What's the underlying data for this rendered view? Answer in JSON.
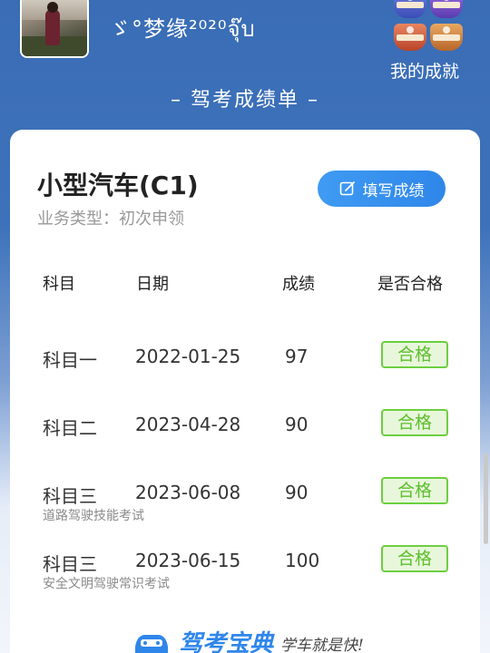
{
  "header": {
    "nickname": "ゞ°梦缘²⁰²⁰จุ๊บ",
    "my_scores_label": "我的成就",
    "page_heading": "– 驾考成绩单 –"
  },
  "card": {
    "vehicle_title": "小型汽车(C1)",
    "business_type": "业务类型：初次申领",
    "fill_button_label": "填写成绩",
    "columns": [
      "科目",
      "日期",
      "成绩",
      "是否合格"
    ],
    "rows": [
      {
        "subject": "科目一",
        "date": "2022-01-25",
        "score": "97",
        "result": "合格",
        "note": ""
      },
      {
        "subject": "科目二",
        "date": "2023-04-28",
        "score": "90",
        "result": "合格",
        "note": ""
      },
      {
        "subject": "科目三",
        "date": "2023-06-08",
        "score": "90",
        "result": "合格",
        "note": "道路驾驶技能考试"
      },
      {
        "subject": "科目三",
        "date": "2023-06-15",
        "score": "100",
        "result": "合格",
        "note": "安全文明驾驶常识考试"
      }
    ]
  },
  "footer": {
    "logo_name": "驾考宝典",
    "slogan": "学车就是快!"
  },
  "colors": {
    "header_blue": "#3a6db5",
    "button_blue": "#2f86ea",
    "pass_green": "#5cbf2c"
  },
  "icons": [
    "edit-icon",
    "car-logo-icon"
  ]
}
